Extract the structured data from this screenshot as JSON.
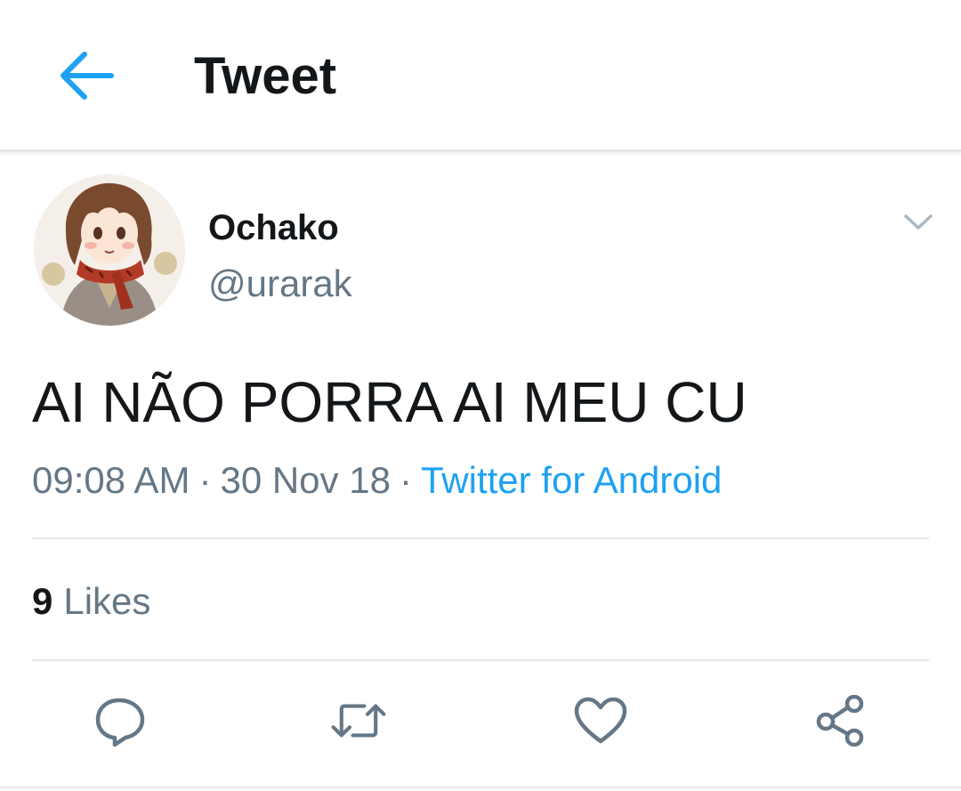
{
  "header": {
    "title": "Tweet",
    "back_icon": "arrow-left-icon",
    "accent_color": "#1da1f2"
  },
  "tweet": {
    "author": {
      "display_name": "Ochako",
      "handle": "@urarak",
      "avatar": "avatar-illustration"
    },
    "text": "AI NÃO PORRA AI MEU CU",
    "time": "09:08 AM",
    "date": "30 Nov 18",
    "separator": "·",
    "source": "Twitter for Android",
    "likes": {
      "count": "9",
      "label": "Likes"
    }
  },
  "actions": [
    {
      "name": "reply",
      "icon": "reply-icon"
    },
    {
      "name": "retweet",
      "icon": "retweet-icon"
    },
    {
      "name": "like",
      "icon": "heart-icon"
    },
    {
      "name": "share",
      "icon": "share-icon"
    }
  ],
  "colors": {
    "text_primary": "#14171a",
    "text_secondary": "#657786",
    "link": "#1da1f2",
    "divider": "#e1e8ed"
  }
}
